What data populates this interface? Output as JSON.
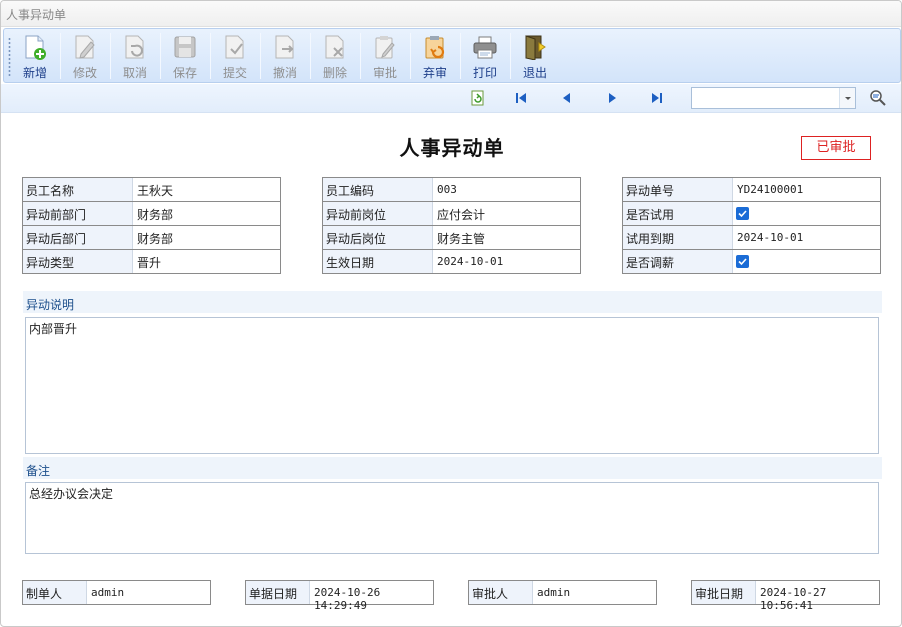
{
  "window": {
    "title": "人事异动单"
  },
  "toolbar": {
    "buttons": [
      {
        "key": "new",
        "label": "新增",
        "enabled": true
      },
      {
        "key": "edit",
        "label": "修改",
        "enabled": false
      },
      {
        "key": "cancel",
        "label": "取消",
        "enabled": false
      },
      {
        "key": "save",
        "label": "保存",
        "enabled": false
      },
      {
        "key": "submit",
        "label": "提交",
        "enabled": false
      },
      {
        "key": "revoke",
        "label": "撤消",
        "enabled": false
      },
      {
        "key": "delete",
        "label": "删除",
        "enabled": false
      },
      {
        "key": "approve",
        "label": "审批",
        "enabled": false
      },
      {
        "key": "abandon",
        "label": "弃审",
        "enabled": true
      },
      {
        "key": "print",
        "label": "打印",
        "enabled": true
      },
      {
        "key": "exit",
        "label": "退出",
        "enabled": true
      }
    ]
  },
  "navbar": {
    "search_value": ""
  },
  "form": {
    "title": "人事异动单",
    "status": "已审批",
    "left": [
      {
        "label": "员工名称",
        "value": "王秋天"
      },
      {
        "label": "异动前部门",
        "value": "财务部"
      },
      {
        "label": "异动后部门",
        "value": "财务部"
      },
      {
        "label": "异动类型",
        "value": "晋升"
      }
    ],
    "middle": [
      {
        "label": "员工编码",
        "value": "003"
      },
      {
        "label": "异动前岗位",
        "value": "应付会计"
      },
      {
        "label": "异动后岗位",
        "value": "财务主管"
      },
      {
        "label": "生效日期",
        "value": "2024-10-01"
      }
    ],
    "right": [
      {
        "label": "异动单号",
        "value": "YD24100001"
      },
      {
        "label": "是否试用",
        "checked": true
      },
      {
        "label": "试用到期",
        "value": "2024-10-01"
      },
      {
        "label": "是否调薪",
        "checked": true
      }
    ],
    "description": {
      "label": "异动说明",
      "value": "内部晋升"
    },
    "remark": {
      "label": "备注",
      "value": "总经办议会决定"
    }
  },
  "footer": [
    {
      "label": "制单人",
      "value": "admin"
    },
    {
      "label": "单据日期",
      "value": "2024-10-26 14:29:49"
    },
    {
      "label": "审批人",
      "value": "admin"
    },
    {
      "label": "审批日期",
      "value": "2024-10-27 10:56:41"
    }
  ],
  "colors": {
    "status": "#dd2222",
    "accent": "#1b6cd6",
    "label_bg": "#eef3fb",
    "section_text": "#1d4f8c"
  }
}
